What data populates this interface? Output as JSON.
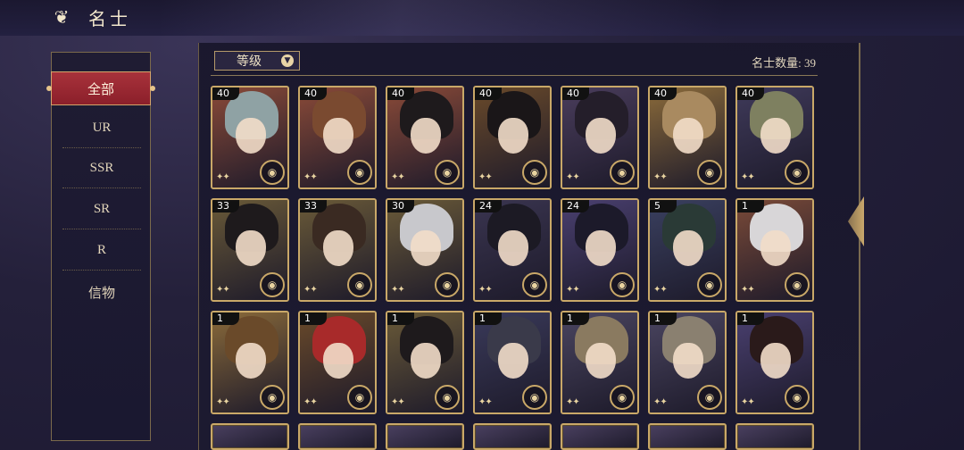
{
  "header": {
    "title": "名士",
    "back_icon": "back-swirl-icon"
  },
  "sidebar": {
    "items": [
      {
        "label": "全部",
        "active": true
      },
      {
        "label": "UR"
      },
      {
        "label": "SSR"
      },
      {
        "label": "SR"
      },
      {
        "label": "R"
      },
      {
        "label": "信物"
      }
    ]
  },
  "filter": {
    "label": "等级",
    "icon": "chevron-down-icon"
  },
  "count": {
    "text": "名士数量: 39"
  },
  "cards": [
    {
      "level": "40",
      "bg": "#8a4a38",
      "hair": "#8fa2a4"
    },
    {
      "level": "40",
      "bg": "#8a4a38",
      "hair": "#7a4a30"
    },
    {
      "level": "40",
      "bg": "#8a4a38",
      "hair": "#1e1a1c"
    },
    {
      "level": "40",
      "bg": "#6a4a2a",
      "hair": "#1a1618"
    },
    {
      "level": "40",
      "bg": "#4a3d5c",
      "hair": "#241e2a"
    },
    {
      "level": "40",
      "bg": "#8a6a3a",
      "hair": "#a98a60"
    },
    {
      "level": "40",
      "bg": "#3f3a5a",
      "hair": "#7e8060"
    },
    {
      "level": "33",
      "bg": "#6a5a38",
      "hair": "#1e1a1c"
    },
    {
      "level": "33",
      "bg": "#6a5a38",
      "hair": "#3a2a22"
    },
    {
      "level": "30",
      "bg": "#6a5a38",
      "hair": "#c8c8cc"
    },
    {
      "level": "24",
      "bg": "#3a3550",
      "hair": "#1c1a24"
    },
    {
      "level": "24",
      "bg": "#4a4070",
      "hair": "#1c1a2a"
    },
    {
      "level": "5",
      "bg": "#3a4060",
      "hair": "#2a3a36"
    },
    {
      "level": "1",
      "bg": "#7a4a38",
      "hair": "#d8d6d8"
    },
    {
      "level": "1",
      "bg": "#8a6a3a",
      "hair": "#6a4a2a"
    },
    {
      "level": "1",
      "bg": "#6a4a2a",
      "hair": "#a82a2a"
    },
    {
      "level": "1",
      "bg": "#6a5a38",
      "hair": "#1e1a1c"
    },
    {
      "level": "1",
      "bg": "#3a3a5a",
      "hair": "#3a3a4a"
    },
    {
      "level": "1",
      "bg": "#4a4560",
      "hair": "#8a7a60"
    },
    {
      "level": "1",
      "bg": "#4a4560",
      "hair": "#8a8070"
    },
    {
      "level": "1",
      "bg": "#4a4070",
      "hair": "#2a1a1a"
    }
  ],
  "colors": {
    "accent_red": "#9b2631",
    "gold_border": "#c9a868"
  }
}
